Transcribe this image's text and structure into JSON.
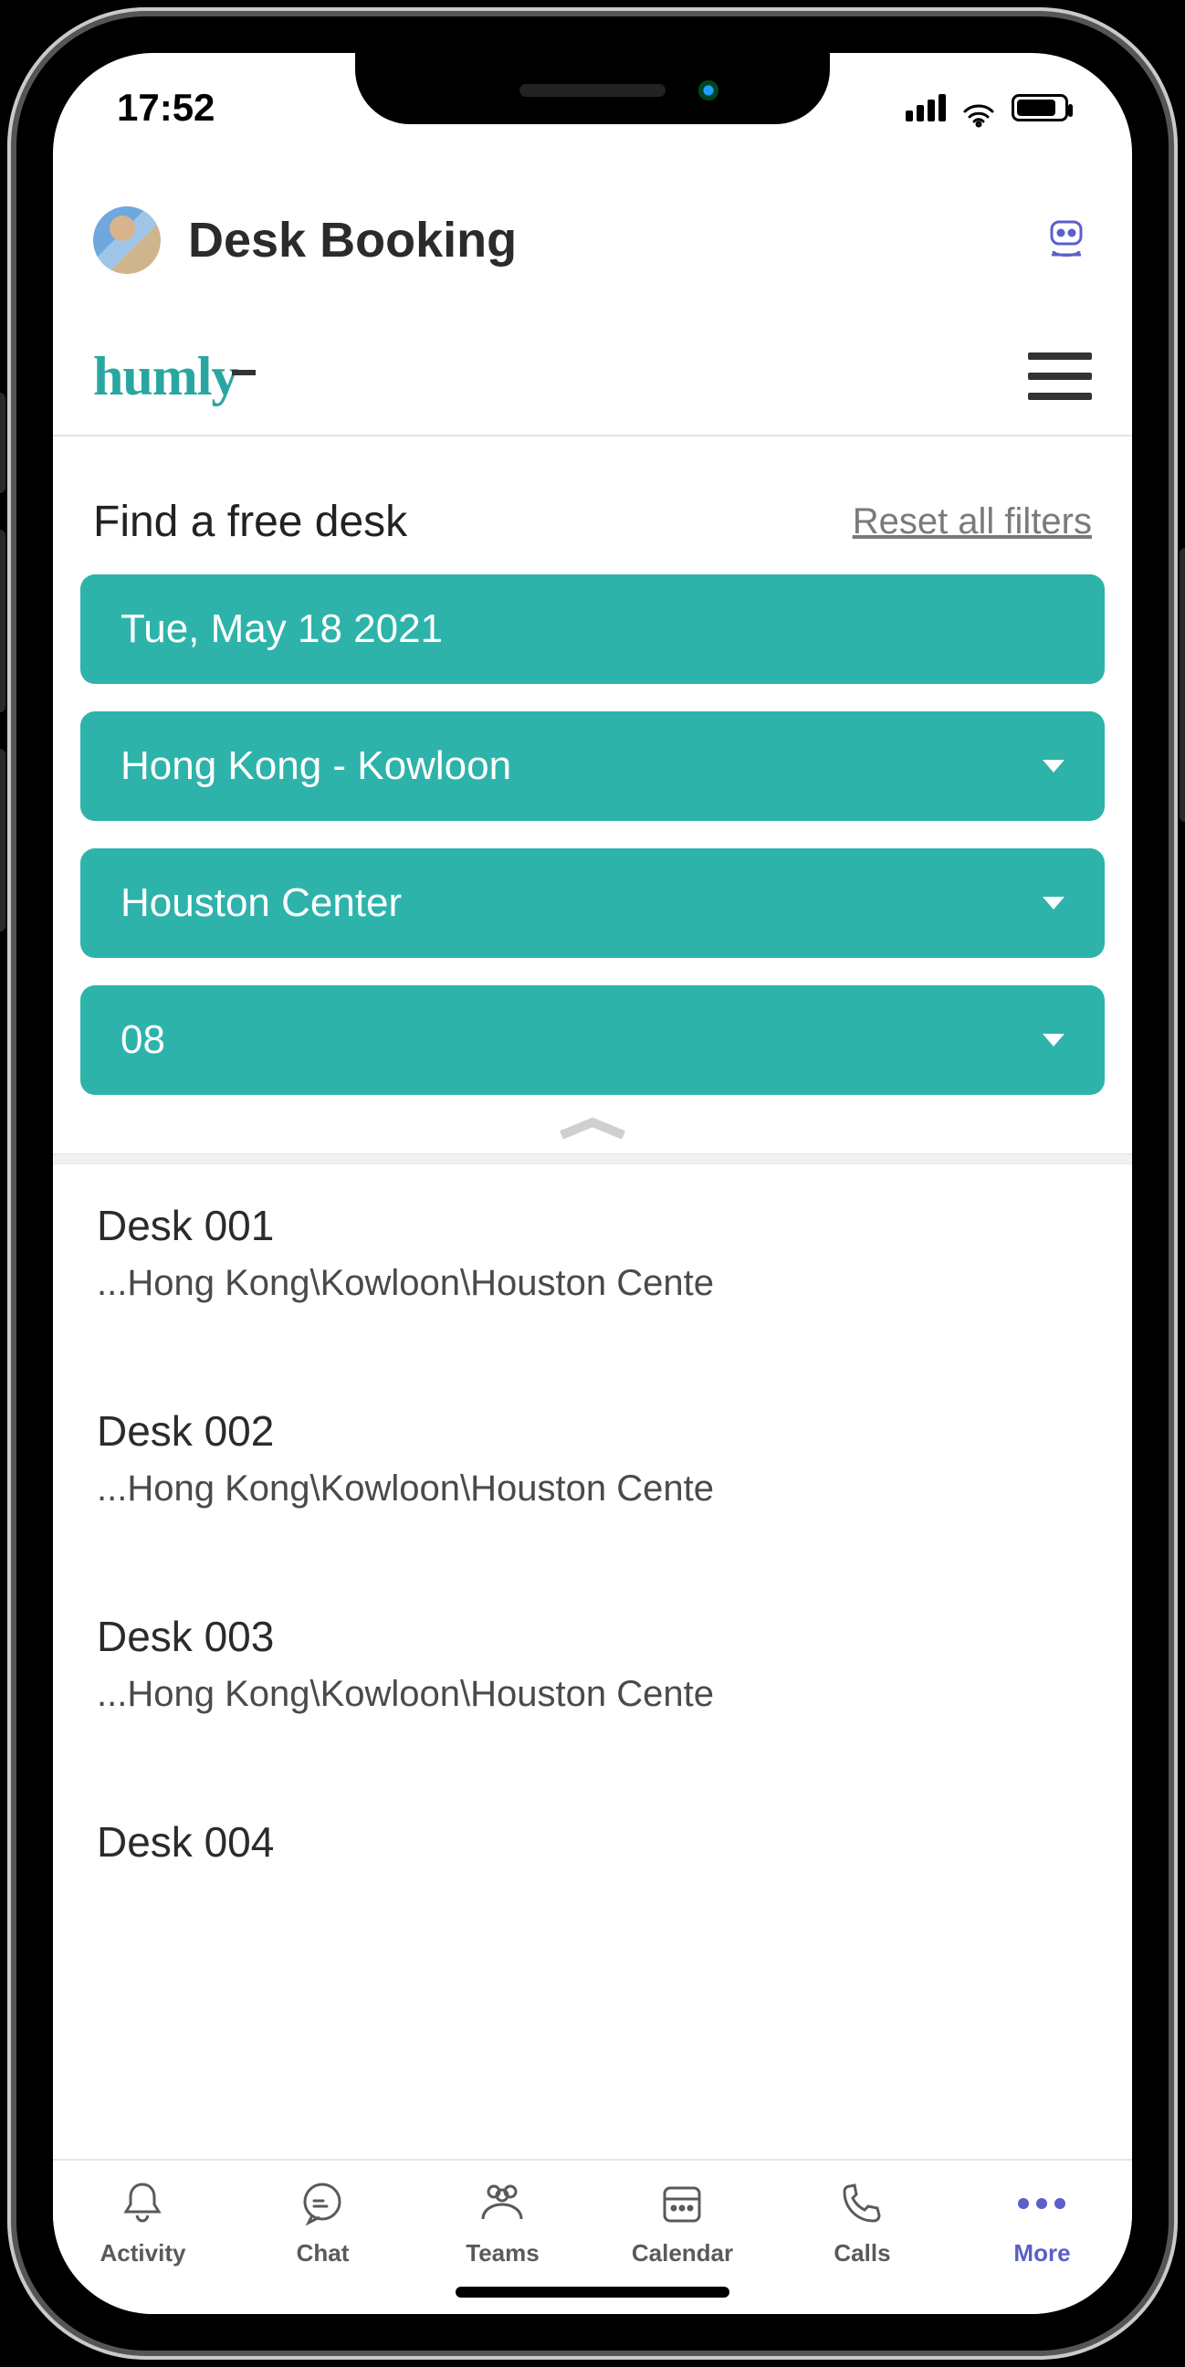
{
  "statusbar": {
    "time": "17:52"
  },
  "header": {
    "title": "Desk Booking"
  },
  "brand": {
    "logo": "humly"
  },
  "search": {
    "heading": "Find a free desk",
    "reset": "Reset all filters"
  },
  "filters": {
    "date": "Tue, May 18 2021",
    "city": "Hong Kong - Kowloon",
    "building": "Houston Center",
    "floor": "08"
  },
  "results": [
    {
      "title": "Desk 001",
      "path": "...Hong Kong\\Kowloon\\Houston Cente"
    },
    {
      "title": "Desk 002",
      "path": "...Hong Kong\\Kowloon\\Houston Cente"
    },
    {
      "title": "Desk 003",
      "path": "...Hong Kong\\Kowloon\\Houston Cente"
    },
    {
      "title": "Desk 004",
      "path": ""
    }
  ],
  "tabs": {
    "activity": "Activity",
    "chat": "Chat",
    "teams": "Teams",
    "calendar": "Calendar",
    "calls": "Calls",
    "more": "More"
  }
}
